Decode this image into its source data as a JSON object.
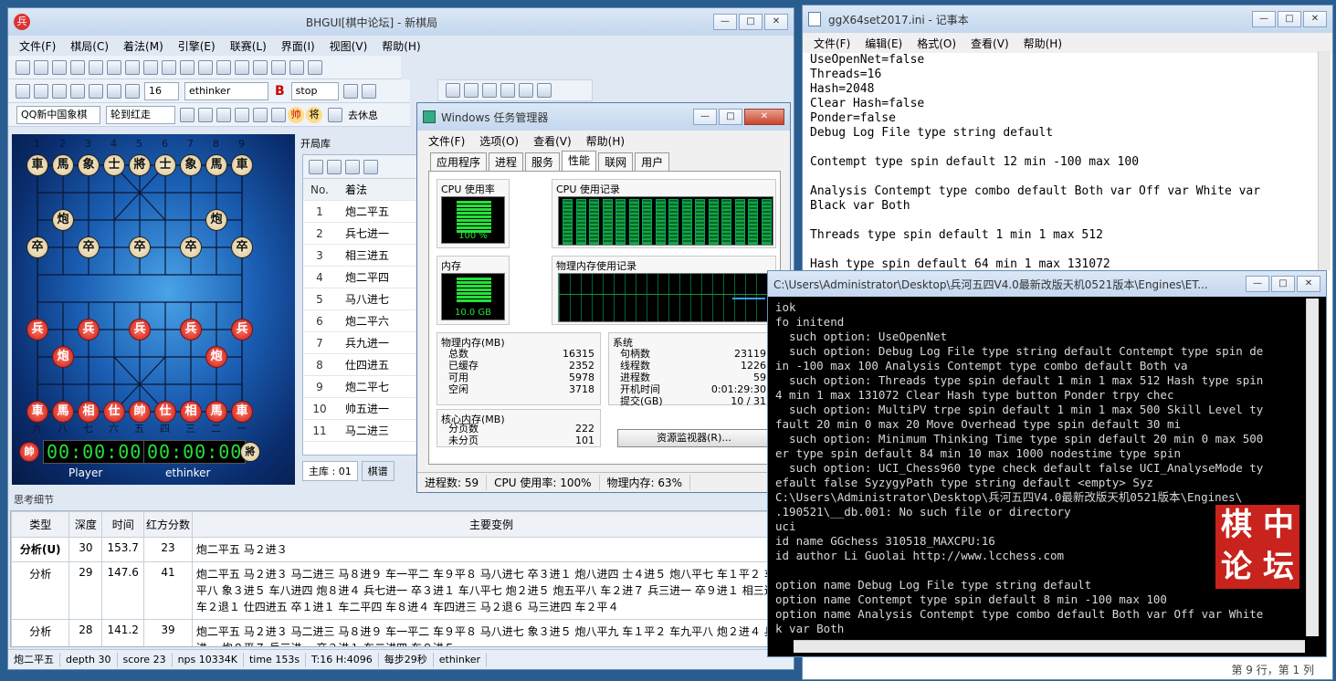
{
  "bhgui": {
    "title": "BHGUI[棋中论坛] - 新棋局",
    "menu": [
      "文件(F)",
      "棋局(C)",
      "着法(M)",
      "引擎(E)",
      "联赛(L)",
      "界面(I)",
      "视图(V)",
      "帮助(H)"
    ],
    "depth_select": "16",
    "engine_select": "ethinker",
    "stop_label": "stop",
    "platform_select": "QQ新中国象棋",
    "turn_select": "轮到红走",
    "rest_label": "去休息",
    "opening_label": "开局库",
    "moves_header": {
      "no": "No.",
      "move": "着法"
    },
    "moves": [
      {
        "no": "1",
        "m": "炮二平五"
      },
      {
        "no": "2",
        "m": "兵七进一"
      },
      {
        "no": "3",
        "m": "相三进五"
      },
      {
        "no": "4",
        "m": "炮二平四"
      },
      {
        "no": "5",
        "m": "马八进七"
      },
      {
        "no": "6",
        "m": "炮二平六"
      },
      {
        "no": "7",
        "m": "兵九进一"
      },
      {
        "no": "8",
        "m": "仕四进五"
      },
      {
        "no": "9",
        "m": "炮二平七"
      },
      {
        "no": "10",
        "m": "帅五进一"
      },
      {
        "no": "11",
        "m": "马二进三"
      }
    ],
    "book_tab": "主库 : 01",
    "score_tab": "棋谱",
    "col_numbers_top": [
      "1",
      "2",
      "3",
      "4",
      "5",
      "6",
      "7",
      "8",
      "9"
    ],
    "col_numbers_bottom": [
      "九",
      "八",
      "七",
      "六",
      "五",
      "四",
      "三",
      "二",
      "一"
    ],
    "clock_left": "00:00:00",
    "clock_right": "00:00:00",
    "player_left": "Player",
    "player_right": "ethinker",
    "side_left": "帥",
    "side_right": "將",
    "think_label": "思考细节",
    "think_headers": [
      "类型",
      "深度",
      "时间",
      "红方分数",
      "主要变例"
    ],
    "think_rows": [
      {
        "type": "分析(U)",
        "depth": "30",
        "time": "153.7",
        "score": "23",
        "pv": "炮二平五 马２进３"
      },
      {
        "type": "分析",
        "depth": "29",
        "time": "147.6",
        "score": "41",
        "pv": "炮二平五 马２进３ 马二进三 马８进９ 车一平二 车９平８ 马八进七 卒３进１ 炮八进四 士４进５ 炮八平七 车１平２ 车九平八 象３进５ 车八进四 炮８进４ 兵七进一 卒３进１ 车八平七 炮２进５ 炮五平八 车２进７ 兵三进一 卒９进１ 相三进五 车２退１ 仕四进五 卒１进１ 车二平四 车８进４ 车四进三 马２退６ 马三进四 车２平４"
      },
      {
        "type": "分析",
        "depth": "28",
        "time": "141.2",
        "score": "39",
        "pv": "炮二平五 马２进３ 马二进三 马８进９ 车一平二 车９平８ 马八进七 象３进５ 炮八平九 车１平２ 车九平八 炮２进４ 兵七进一 炮８平７ 兵三进一 卒３进１ 车二进四 车８进５"
      }
    ],
    "status": [
      "炮二平五",
      "depth 30",
      "score 23",
      "nps 10334K",
      "time 153s",
      "T:16 H:4096",
      "每步29秒",
      "ethinker"
    ]
  },
  "notepad": {
    "title": "ggX64set2017.ini - 记事本",
    "menu": [
      "文件(F)",
      "编辑(E)",
      "格式(O)",
      "查看(V)",
      "帮助(H)"
    ],
    "lines": [
      "UseOpenNet=false",
      "Threads=16",
      "Hash=2048",
      "Clear Hash=false",
      "Ponder=false",
      "Debug Log File type string default",
      "",
      "Contempt type spin default 12 min -100 max 100",
      "",
      "Analysis Contempt type combo default Both var Off var White var",
      "Black var Both",
      "",
      "Threads type spin default 1 min 1 max 512",
      "",
      "Hash type spin default 64 min 1 max 131072"
    ],
    "status": "第 9 行，第 1 列"
  },
  "taskmgr": {
    "title": "Windows 任务管理器",
    "menu": [
      "文件(F)",
      "选项(O)",
      "查看(V)",
      "帮助(H)"
    ],
    "tabs": [
      "应用程序",
      "进程",
      "服务",
      "性能",
      "联网",
      "用户"
    ],
    "active_tab": "性能",
    "cpu_usage_label": "CPU 使用率",
    "cpu_value": "100 %",
    "cpu_history_label": "CPU 使用记录",
    "mem_label": "内存",
    "mem_value": "10.0 GB",
    "mem_history_label": "物理内存使用记录",
    "phys_mem_label": "物理内存(MB)",
    "phys_mem": [
      {
        "k": "总数",
        "v": "16315"
      },
      {
        "k": "已缓存",
        "v": "2352"
      },
      {
        "k": "可用",
        "v": "5978"
      },
      {
        "k": "空闲",
        "v": "3718"
      }
    ],
    "system_label": "系统",
    "system": [
      {
        "k": "句柄数",
        "v": "23119"
      },
      {
        "k": "线程数",
        "v": "1226"
      },
      {
        "k": "进程数",
        "v": "59"
      },
      {
        "k": "开机时间",
        "v": "0:01:29:30"
      },
      {
        "k": "提交(GB)",
        "v": "10 / 31"
      }
    ],
    "kernel_label": "核心内存(MB)",
    "kernel": [
      {
        "k": "分页数",
        "v": "222"
      },
      {
        "k": "未分页",
        "v": "101"
      }
    ],
    "resmon_button": "资源监视器(R)...",
    "status": [
      "进程数: 59",
      "CPU 使用率: 100%",
      "物理内存: 63%"
    ]
  },
  "console": {
    "title": "C:\\Users\\Administrator\\Desktop\\兵河五四V4.0最新改版天机0521版本\\Engines\\ET...",
    "lines": [
      "iok",
      "fo initend",
      "  such option: UseOpenNet",
      "  such option: Debug Log File type string default Contempt type spin de",
      "in -100 max 100 Analysis Contempt type combo default Both va",
      "  such option: Threads type spin default 1 min 1 max 512 Hash type spin",
      "4 min 1 max 131072 Clear Hash type button Ponder trpy chec",
      "  such option: MultiPV trpe spin default 1 min 1 max 500 Skill Level ty",
      "fault 20 min 0 max 20 Move Overhead type spin default 30 mi",
      "  such option: Minimum Thinking Time type spin default 20 min 0 max 500",
      "er type spin default 84 min 10 max 1000 nodestime type spin",
      "  such option: UCI_Chess960 type check default false UCI_AnalyseMode ty",
      "efault false SyzygyPath type string default <empty> Syz",
      "C:\\Users\\Administrator\\Desktop\\兵河五四V4.0最新改版天机0521版本\\Engines\\",
      ".190521\\__db.001: No such file or directory",
      "uci",
      "id name GGchess 310518_MAXCPU:16",
      "id author Li Guolai http://www.lcchess.com",
      "",
      "option name Debug Log File type string default",
      "option name Contempt type spin default 8 min -100 max 100",
      "option name Analysis Contempt type combo default Both var Off var White",
      "k var Both"
    ],
    "logo": [
      "棋",
      "中",
      "论",
      "坛"
    ]
  },
  "colors": {
    "red_piece": "#c81a14",
    "black_piece": "#d9c392",
    "clock_green": "#25e03a",
    "logo_red": "#c8231d"
  }
}
